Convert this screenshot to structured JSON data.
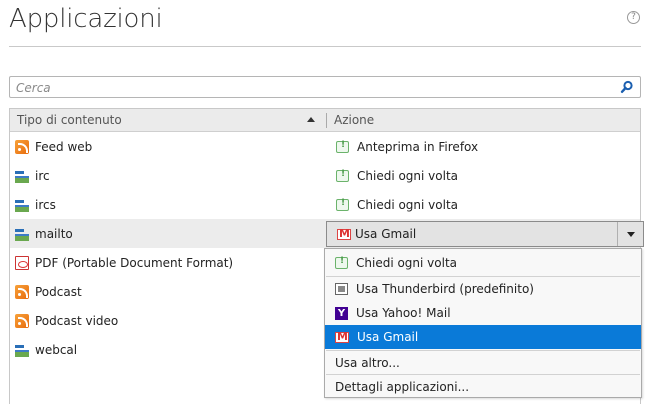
{
  "page": {
    "title": "Applicazioni",
    "help_icon": "question-icon",
    "help_glyph": "?"
  },
  "search": {
    "placeholder": "Cerca",
    "icon": "search-icon"
  },
  "table": {
    "headers": {
      "content_type": "Tipo di contenuto",
      "action": "Azione"
    },
    "rows": [
      {
        "type": "Feed web",
        "type_icon": "rss-icon",
        "action": "Anteprima in Firefox",
        "action_icon": "preview-icon"
      },
      {
        "type": "irc",
        "type_icon": "app-icon",
        "action": "Chiedi ogni volta",
        "action_icon": "ask-icon"
      },
      {
        "type": "ircs",
        "type_icon": "app-icon",
        "action": "Chiedi ogni volta",
        "action_icon": "ask-icon"
      },
      {
        "type": "mailto",
        "type_icon": "app-icon",
        "action": "Usa Gmail",
        "action_icon": "gmail-icon"
      },
      {
        "type": "PDF (Portable Document Format)",
        "type_icon": "pdf-icon",
        "action": "",
        "action_icon": ""
      },
      {
        "type": "Podcast",
        "type_icon": "rss-icon",
        "action": "",
        "action_icon": ""
      },
      {
        "type": "Podcast video",
        "type_icon": "rss-icon",
        "action": "",
        "action_icon": ""
      },
      {
        "type": "webcal",
        "type_icon": "app-icon",
        "action": "",
        "action_icon": ""
      }
    ]
  },
  "dropdown": {
    "selected": "Usa Gmail",
    "options": [
      {
        "label": "Chiedi ogni volta",
        "icon": "ask-icon"
      },
      {
        "label": "Usa Thunderbird (predefinito)",
        "icon": "thunderbird-icon"
      },
      {
        "label": "Usa Yahoo! Mail",
        "icon": "yahoo-icon",
        "glyph": "Y"
      },
      {
        "label": "Usa Gmail",
        "icon": "gmail-icon",
        "highlighted": true
      },
      {
        "label": "Usa altro...",
        "icon": ""
      },
      {
        "label": "Dettagli applicazioni...",
        "icon": ""
      }
    ]
  },
  "colors": {
    "highlight": "#0a7ad8",
    "selected_row": "#ececec",
    "header_bg": "#ebebeb"
  }
}
